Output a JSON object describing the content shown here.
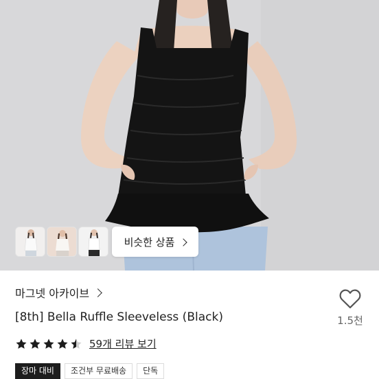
{
  "gallery": {
    "similar_button_label": "비슷한 상품",
    "thumbnails": [
      "thumbnail-1",
      "thumbnail-2",
      "thumbnail-3"
    ]
  },
  "product": {
    "store_name": "마그넷 아카이브",
    "title": "[8th] Bella Ruffle Sleeveless (Black)",
    "rating": 4.5,
    "review_count_label": "59개 리뷰 보기",
    "like_count": "1.5천"
  },
  "tags": [
    "장마 대비",
    "조건부 무료배송",
    "단독"
  ],
  "icons": {
    "heart": "heart-outline-icon",
    "star": "star-icon",
    "chevron": "chevron-right-icon"
  },
  "colors": {
    "text": "#222222",
    "muted": "#666666",
    "tag_dark_bg": "#1d1d1d",
    "star": "#1d1d1d"
  }
}
